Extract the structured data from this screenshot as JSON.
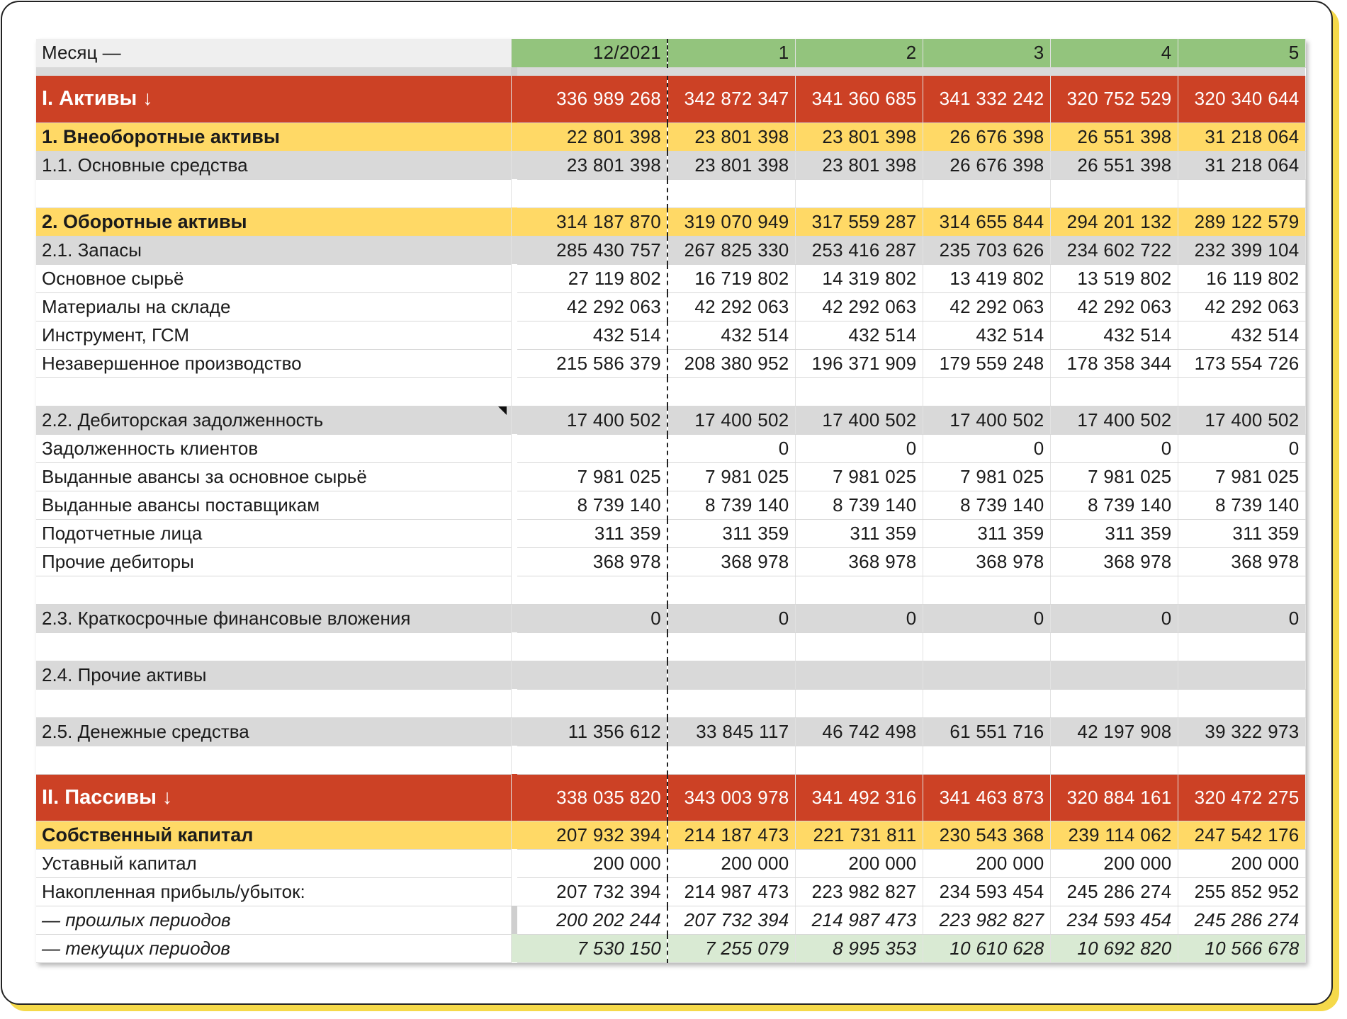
{
  "header": {
    "label": "Месяц —",
    "months": [
      "12/2021",
      "1",
      "2",
      "3",
      "4",
      "5"
    ]
  },
  "rows": [
    {
      "type": "section",
      "label": "I. Активы ↓",
      "values": [
        "336 989 268",
        "342 872 347",
        "341 360 685",
        "341 332 242",
        "320 752 529",
        "320 340 644"
      ]
    },
    {
      "type": "group",
      "label": "1. Внеоборотные активы",
      "values": [
        "22 801 398",
        "23 801 398",
        "23 801 398",
        "26 676 398",
        "26 551 398",
        "31 218 064"
      ]
    },
    {
      "type": "sub",
      "label": "1.1. Основные средства",
      "values": [
        "23 801 398",
        "23 801 398",
        "23 801 398",
        "26 676 398",
        "26 551 398",
        "31 218 064"
      ]
    },
    {
      "type": "empty",
      "label": "",
      "values": [
        "",
        "",
        "",
        "",
        "",
        ""
      ]
    },
    {
      "type": "group",
      "label": "2. Оборотные активы",
      "values": [
        "314 187 870",
        "319 070 949",
        "317 559 287",
        "314 655 844",
        "294 201 132",
        "289 122 579"
      ]
    },
    {
      "type": "sub",
      "label": "2.1. Запасы",
      "values": [
        "285 430 757",
        "267 825 330",
        "253 416 287",
        "235 703 626",
        "234 602 722",
        "232 399 104"
      ]
    },
    {
      "type": "detail",
      "label": "Основное сырьё",
      "values": [
        "27 119 802",
        "16 719 802",
        "14 319 802",
        "13 419 802",
        "13 519 802",
        "16 119 802"
      ]
    },
    {
      "type": "detail",
      "label": "Материалы на складе",
      "values": [
        "42 292 063",
        "42 292 063",
        "42 292 063",
        "42 292 063",
        "42 292 063",
        "42 292 063"
      ]
    },
    {
      "type": "detail",
      "label": "Инструмент, ГСМ",
      "values": [
        "432 514",
        "432 514",
        "432 514",
        "432 514",
        "432 514",
        "432 514"
      ]
    },
    {
      "type": "detail",
      "label": "Незавершенное производство",
      "values": [
        "215 586 379",
        "208 380 952",
        "196 371 909",
        "179 559 248",
        "178 358 344",
        "173 554 726"
      ]
    },
    {
      "type": "empty",
      "label": "",
      "values": [
        "",
        "",
        "",
        "",
        "",
        ""
      ]
    },
    {
      "type": "sub",
      "label": "2.2. Дебиторская задолженность",
      "flag": true,
      "values": [
        "17 400 502",
        "17 400 502",
        "17 400 502",
        "17 400 502",
        "17 400 502",
        "17 400 502"
      ]
    },
    {
      "type": "detail",
      "label": "Задолженность клиентов",
      "values": [
        "",
        "0",
        "0",
        "0",
        "0",
        "0"
      ]
    },
    {
      "type": "detail",
      "label": "Выданные авансы за основное сырьё",
      "values": [
        "7 981 025",
        "7 981 025",
        "7 981 025",
        "7 981 025",
        "7 981 025",
        "7 981 025"
      ]
    },
    {
      "type": "detail",
      "label": "Выданные авансы поставщикам",
      "values": [
        "8 739 140",
        "8 739 140",
        "8 739 140",
        "8 739 140",
        "8 739 140",
        "8 739 140"
      ]
    },
    {
      "type": "detail",
      "label": "Подотчетные лица",
      "values": [
        "311 359",
        "311 359",
        "311 359",
        "311 359",
        "311 359",
        "311 359"
      ]
    },
    {
      "type": "detail",
      "label": "Прочие дебиторы",
      "values": [
        "368 978",
        "368 978",
        "368 978",
        "368 978",
        "368 978",
        "368 978"
      ]
    },
    {
      "type": "empty",
      "label": "",
      "values": [
        "",
        "",
        "",
        "",
        "",
        ""
      ]
    },
    {
      "type": "sub",
      "label": "2.3. Краткосрочные финансовые вложения",
      "values": [
        "0",
        "0",
        "0",
        "0",
        "0",
        "0"
      ]
    },
    {
      "type": "empty",
      "label": "",
      "values": [
        "",
        "",
        "",
        "",
        "",
        ""
      ]
    },
    {
      "type": "sub",
      "label": "2.4. Прочие активы",
      "values": [
        "",
        "",
        "",
        "",
        "",
        ""
      ]
    },
    {
      "type": "empty",
      "label": "",
      "values": [
        "",
        "",
        "",
        "",
        "",
        ""
      ]
    },
    {
      "type": "sub",
      "label": "2.5. Денежные средства",
      "values": [
        "11 356 612",
        "33 845 117",
        "46 742 498",
        "61 551 716",
        "42 197 908",
        "39 322 973"
      ]
    },
    {
      "type": "empty",
      "label": "",
      "values": [
        "",
        "",
        "",
        "",
        "",
        ""
      ]
    },
    {
      "type": "section",
      "label": "II. Пассивы ↓",
      "values": [
        "338 035 820",
        "343 003 978",
        "341 492 316",
        "341 463 873",
        "320 884 161",
        "320 472 275"
      ]
    },
    {
      "type": "group",
      "label": "Собственный капитал",
      "values": [
        "207 932 394",
        "214 187 473",
        "221 731 811",
        "230 543 368",
        "239 114 062",
        "247 542 176"
      ]
    },
    {
      "type": "detail",
      "label": "Уставный капитал",
      "values": [
        "200 000",
        "200 000",
        "200 000",
        "200 000",
        "200 000",
        "200 000"
      ]
    },
    {
      "type": "detail",
      "label": "Накопленная прибыль/убыток:",
      "values": [
        "207 732 394",
        "214 987 473",
        "223 982 827",
        "234 593 454",
        "245 286 274",
        "255 852 952"
      ]
    },
    {
      "type": "italic",
      "label": "— прошлых периодов",
      "values": [
        "200 202 244",
        "207 732 394",
        "214 987 473",
        "223 982 827",
        "234 593 454",
        "245 286 274"
      ]
    },
    {
      "type": "italic-green",
      "label": "— текущих периодов",
      "values": [
        "7 530 150",
        "7 255 079",
        "8 995 353",
        "10 610 628",
        "10 692 820",
        "10 566 678"
      ]
    }
  ]
}
